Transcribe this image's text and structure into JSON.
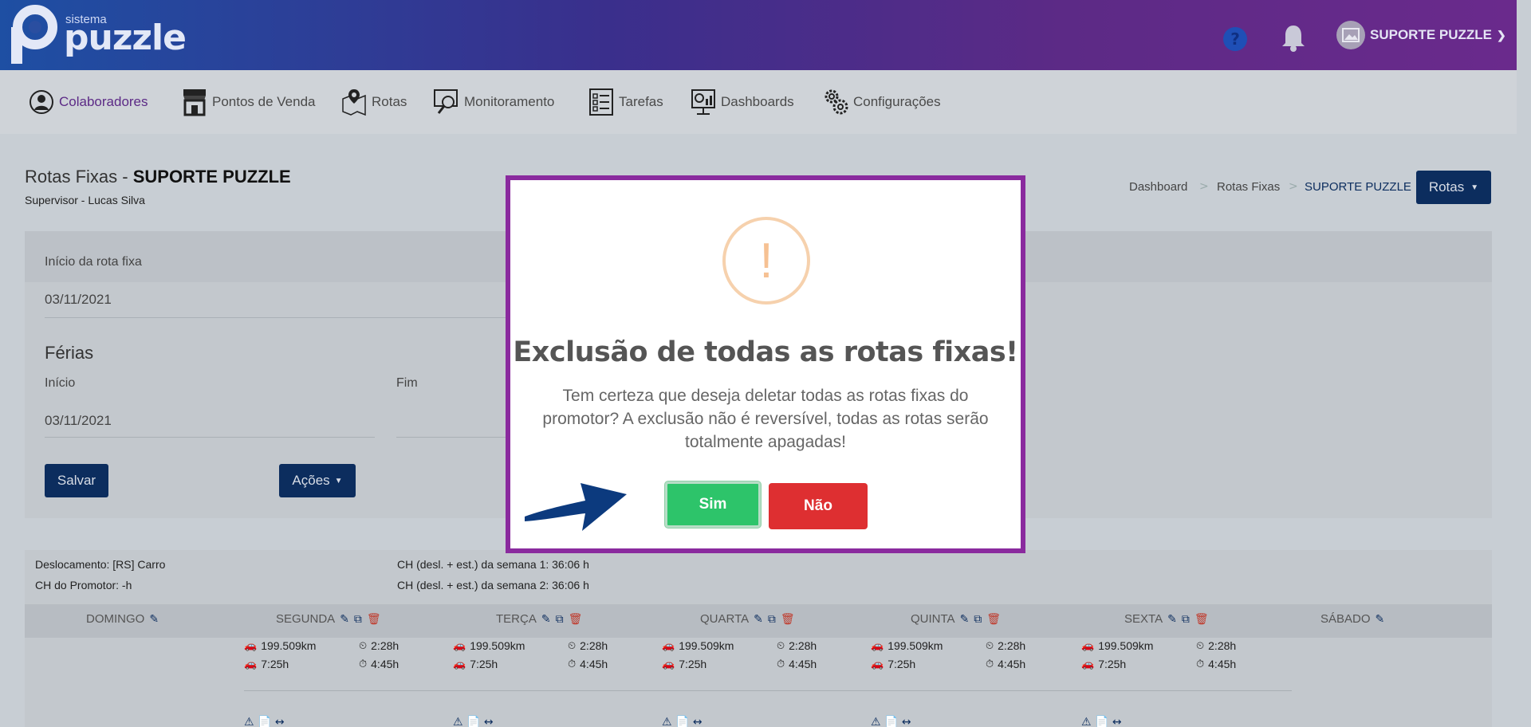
{
  "brand": {
    "sistema": "sistema",
    "name": "puzzle"
  },
  "header": {
    "user_name": "SUPORTE PUZZLE",
    "help_glyph": "?"
  },
  "nav": {
    "items": [
      {
        "label": "Colaboradores",
        "icon": "user-circle-icon",
        "active": true
      },
      {
        "label": "Pontos de Venda",
        "icon": "store-icon"
      },
      {
        "label": "Rotas",
        "icon": "map-pin-icon"
      },
      {
        "label": "Monitoramento",
        "icon": "monitor-search-icon"
      },
      {
        "label": "Tarefas",
        "icon": "checklist-icon"
      },
      {
        "label": "Dashboards",
        "icon": "dashboard-icon"
      },
      {
        "label": "Configurações",
        "icon": "gears-icon"
      }
    ]
  },
  "page": {
    "title_prefix": "Rotas Fixas - ",
    "title_bold": "SUPORTE PUZZLE",
    "subtitle": "Supervisor - Lucas Silva"
  },
  "breadcrumb": {
    "items": [
      "Dashboard",
      "Rotas Fixas",
      "SUPORTE PUZZLE"
    ],
    "separator": ">"
  },
  "rotas_button": "Rotas",
  "form": {
    "start_label": "Início da rota fixa",
    "start_value": "03/11/2021",
    "vacation_title": "Férias",
    "vacation_start_label": "Início",
    "vacation_start_value": "03/11/2021",
    "vacation_end_label": "Fim",
    "save_label": "Salvar",
    "actions_label": "Ações"
  },
  "summary": {
    "travel": "Deslocamento: [RS] Carro",
    "promoter_hours": "CH do Promotor: -h",
    "week1": "CH (desl. + est.) da semana 1: 36:06 h",
    "week2": "CH (desl. + est.) da semana 2: 36:06 h"
  },
  "days": [
    "DOMINGO",
    "SEGUNDA",
    "TERÇA",
    "QUARTA",
    "QUINTA",
    "SEXTA",
    "SÁBADO"
  ],
  "day_stats": {
    "distance": "199.509km",
    "duration1": "2:28h",
    "drive_time": "7:25h",
    "duration2": "4:45h"
  },
  "modal": {
    "icon_glyph": "!",
    "title": "Exclusão de todas as rotas fixas!",
    "text": "Tem certeza que deseja deletar todas as rotas fixas do promotor? A exclusão não é reversível, todas as rotas serão totalmente apagadas!",
    "confirm_label": "Sim",
    "cancel_label": "Não"
  },
  "colors": {
    "modal_border": "#8a2a9e",
    "confirm": "#2dc46a",
    "cancel": "#de2f31",
    "primary": "#0c2d5e",
    "warning": "#f6c193"
  }
}
